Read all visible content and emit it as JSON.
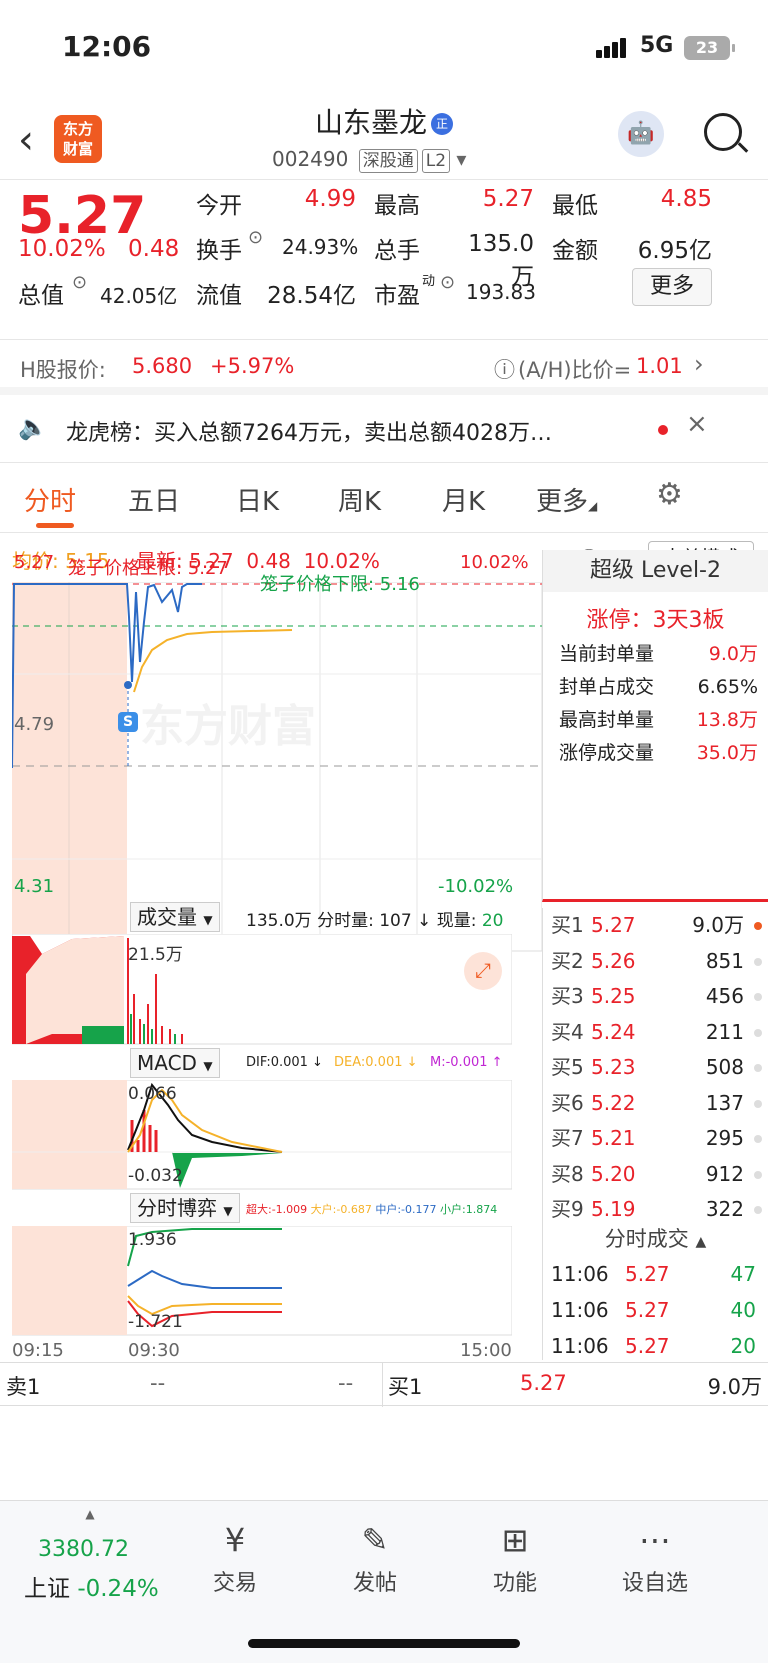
{
  "status": {
    "time": "12:06",
    "network": "5G",
    "battery": "23"
  },
  "header": {
    "stock_name": "山东墨龙",
    "name_badge": "正",
    "code": "002490",
    "tag1": "深股通",
    "tag2": "L2",
    "logo_line1": "东方",
    "logo_line2": "财富"
  },
  "quote": {
    "price": "5.27",
    "change_pct": "10.02%",
    "change": "0.48",
    "open_label": "今开",
    "open": "4.99",
    "high_label": "最高",
    "high": "5.27",
    "low_label": "最低",
    "low": "4.85",
    "turnover_label": "换手",
    "turnover": "24.93%",
    "volume_label": "总手",
    "volume": "135.0万",
    "amount_label": "金额",
    "amount": "6.95亿",
    "mktcap_label": "总值",
    "mktcap": "42.05亿",
    "float_label": "流值",
    "float_cap": "28.54亿",
    "pe_label": "市盈",
    "pe_sup": "动",
    "pe": "193.83",
    "more_button": "更多"
  },
  "hshare": {
    "label": "H股报价:",
    "price": "5.680",
    "change": "+5.97%",
    "ratio_label": "(A/H)比价=",
    "ratio": "1.01"
  },
  "lhb": {
    "text": "龙虎榜：买入总额7264万元，卖出总额4028万…"
  },
  "tabs": [
    "分时",
    "五日",
    "日K",
    "周K",
    "月K",
    "更多"
  ],
  "avgbar": {
    "avg_label": "均价:",
    "avg": "5.15",
    "latest_label": "最新:",
    "latest": "5.27",
    "chg": "0.48",
    "pct": "10.02%",
    "mode_button": "大单模式"
  },
  "chart": {
    "y_top": "5.27",
    "y_mid": "4.79",
    "y_bottom": "4.31",
    "pct_top": "10.02%",
    "pct_bottom": "-10.02%",
    "upper_label": "笼子价格上限: 5.27",
    "lower_label": "笼子价格下限: 5.16",
    "watermark": "东方财富",
    "marker": "S"
  },
  "volume": {
    "title": "成交量",
    "info": "135.0万  分时量: 107 ↓  现量: ",
    "now": "20",
    "max_label": "21.5万"
  },
  "macd": {
    "title": "MACD",
    "dif": "DIF:0.001 ↓",
    "dea": "DEA:0.001 ↓",
    "m": "M:-0.001 ↑",
    "top": "0.066",
    "bottom": "-0.032"
  },
  "game": {
    "title": "分时博弈",
    "big": "超大:-1.009",
    "large": "大户:-0.687",
    "mid": "中户:-0.177",
    "small": "小户:1.874",
    "top": "1.936",
    "bottom": "-1.721"
  },
  "xaxis": {
    "start": "09:15",
    "open": "09:30",
    "end": "15:00"
  },
  "level2": {
    "title": "超级 Level-2",
    "limit": "涨停：3天3板",
    "rows": [
      {
        "label": "当前封单量",
        "value": "9.0万",
        "color": "#e8222a"
      },
      {
        "label": "封单占成交",
        "value": "6.65%",
        "color": "#222"
      },
      {
        "label": "最高封单量",
        "value": "13.8万",
        "color": "#e8222a"
      },
      {
        "label": "涨停成交量",
        "value": "35.0万",
        "color": "#e8222a"
      }
    ]
  },
  "book": [
    {
      "name": "买1",
      "price": "5.27",
      "vol": "9.0万"
    },
    {
      "name": "买2",
      "price": "5.26",
      "vol": "851"
    },
    {
      "name": "买3",
      "price": "5.25",
      "vol": "456"
    },
    {
      "name": "买4",
      "price": "5.24",
      "vol": "211"
    },
    {
      "name": "买5",
      "price": "5.23",
      "vol": "508"
    },
    {
      "name": "买6",
      "price": "5.22",
      "vol": "137"
    },
    {
      "name": "买7",
      "price": "5.21",
      "vol": "295"
    },
    {
      "name": "买8",
      "price": "5.20",
      "vol": "912"
    },
    {
      "name": "买9",
      "price": "5.19",
      "vol": "322"
    }
  ],
  "trades_title": "分时成交",
  "trades": [
    {
      "time": "11:06",
      "price": "5.27",
      "vol": "47"
    },
    {
      "time": "11:06",
      "price": "5.27",
      "vol": "40"
    },
    {
      "time": "11:06",
      "price": "5.27",
      "vol": "20"
    }
  ],
  "bottom_row": {
    "sell1": "卖1",
    "sell1_price": "--",
    "sell1_vol": "--",
    "buy1": "买1",
    "buy1_price": "5.27",
    "buy1_vol": "9.0万"
  },
  "bottomnav": {
    "index_value": "3380.72",
    "index_name": "上证",
    "index_chg": "-0.24%",
    "items": [
      "交易",
      "发帖",
      "功能",
      "设自选"
    ]
  }
}
